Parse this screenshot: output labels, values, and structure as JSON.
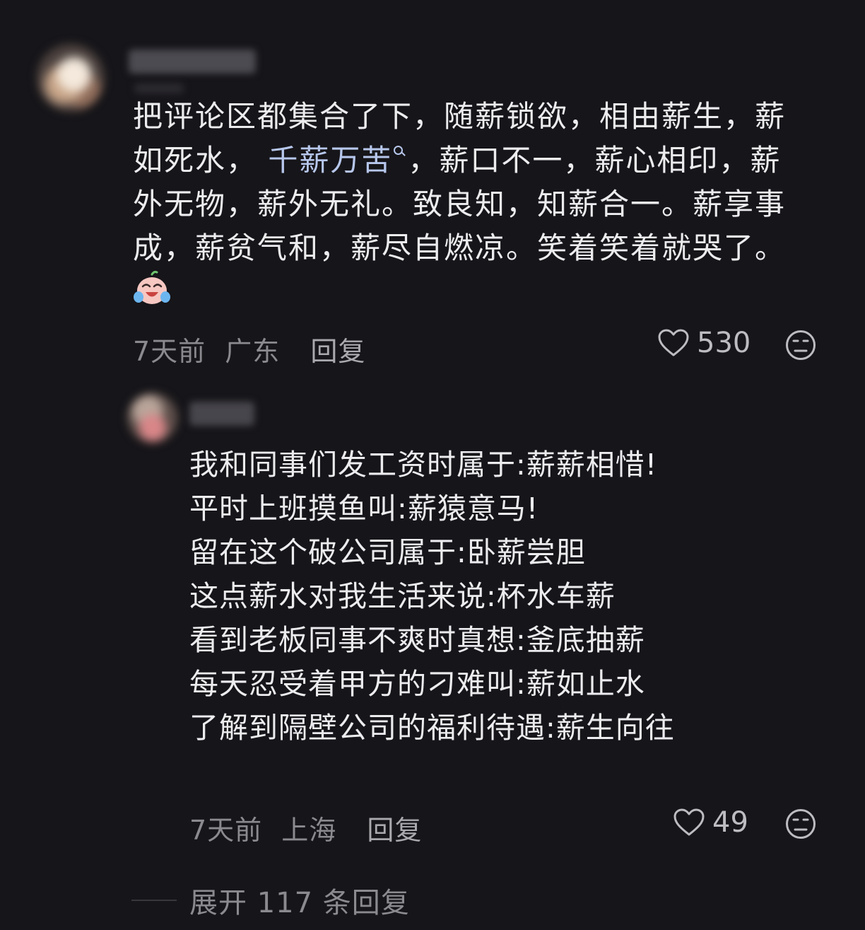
{
  "comment": {
    "lines_before_link": [
      "把评论区都集合了下，随薪锁欲，相由薪生，薪",
      "如死水，"
    ],
    "link_text": "千薪万苦",
    "line2_after_link": "，薪口不一，薪心相印，薪",
    "lines_rest": [
      "外无物，薪外无礼。致良知，知薪合一。薪享事",
      "成，薪贫气和，薪尽自燃凉。笑着笑着就哭了。"
    ],
    "emoji": "crying-laughing-emoji",
    "time": "7天前",
    "location": "广东",
    "reply_label": "回复",
    "likes": "530"
  },
  "reply": {
    "lines": [
      "我和同事们发工资时属于:薪薪相惜!",
      "平时上班摸鱼叫:薪猿意马!",
      "留在这个破公司属于:卧薪尝胆",
      "这点薪水对我生活来说:杯水车薪",
      "看到老板同事不爽时真想:釜底抽薪",
      "每天忍受着甲方的刁难叫:薪如止水",
      "了解到隔壁公司的福利待遇:薪生向往"
    ],
    "time": "7天前",
    "location": "上海",
    "reply_label": "回复",
    "likes": "49"
  },
  "expand_label": "展开 117 条回复",
  "colors": {
    "background": "#161519",
    "text": "#ececef",
    "meta": "#8a8a8f",
    "link": "#b7c7ec"
  }
}
